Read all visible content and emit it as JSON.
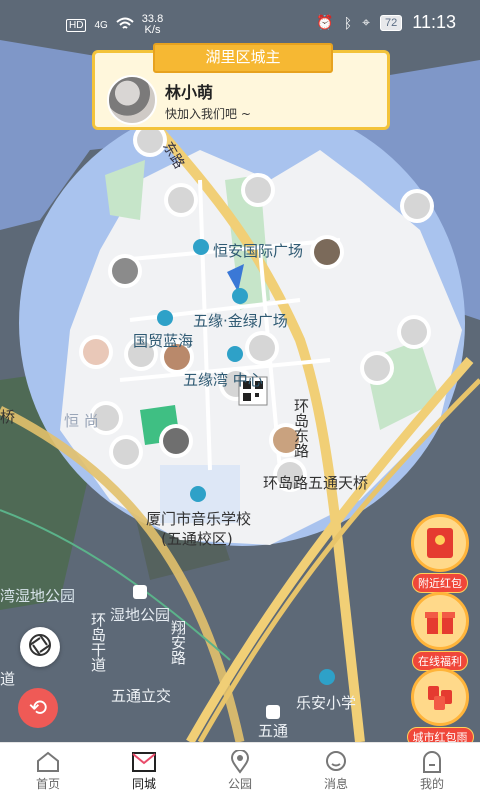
{
  "status": {
    "hd": "HD",
    "signal": "4G",
    "speed_value": "33.8",
    "speed_unit": "K/s",
    "battery": "72",
    "time": "11:13"
  },
  "lord_card": {
    "banner": "湖里区城主",
    "name": "林小萌",
    "message": "快加入我们吧 ~"
  },
  "map_labels": {
    "east_road_top": "东路",
    "hengan": "恒安国际广场",
    "wuyuan_jinlu": "五缘·金绿广场",
    "guomao": "国贸蓝海",
    "wuyuanwan_center": "五缘湾  中心",
    "huandao_east": "环岛东路",
    "wutong_tianqiao": "环岛路五通天桥",
    "heng_shang": "恒  尚",
    "music_school_1": "厦门市音乐学校",
    "music_school_2": "(五通校区)",
    "wetland_park_big": "湾湿地公园",
    "wetland_park": "湿地公园",
    "huandao_ganda": "环岛干道",
    "xiangan_road": "翔安路",
    "wutong_lijiao": "五通立交",
    "lean_school": "乐安小学",
    "wutong": "五通",
    "left_road": "道",
    "left_top": "桥"
  },
  "promos": {
    "nearby_redpack": "附近红包",
    "online_welfare": "在线福利",
    "city_redpack_rain": "城市红包雨"
  },
  "tabs": [
    {
      "label": "首页"
    },
    {
      "label": "同城"
    },
    {
      "label": "公园"
    },
    {
      "label": "消息"
    },
    {
      "label": "我的"
    }
  ],
  "colors": {
    "accent": "#e94b6a",
    "banner": "#f6b833",
    "water": "#a9c3ee",
    "circle": "#f2f3f5"
  }
}
